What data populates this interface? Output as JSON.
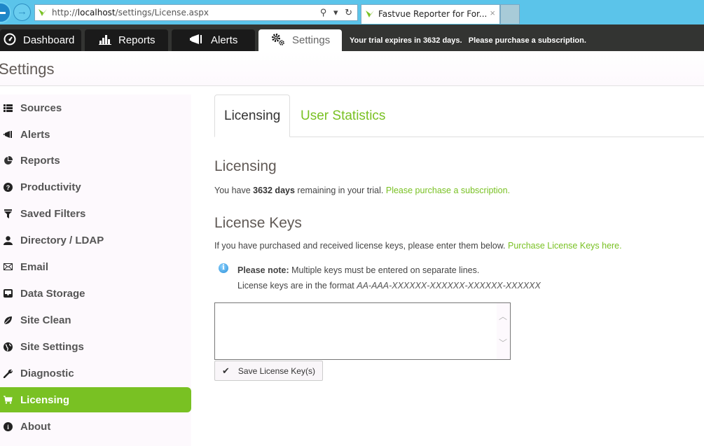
{
  "browser": {
    "url_prefix": "http://",
    "url_host": "localhost",
    "url_path": "/settings/License.aspx",
    "tab_title": "Fastvue Reporter for For...",
    "tab_close": "×",
    "address_tools": "⚲ ▾ ↻",
    "forward_glyph": "→"
  },
  "nav": {
    "tabs": [
      {
        "label": "Dashboard",
        "icon": "dashboard-gauge-icon",
        "glyph": "◔"
      },
      {
        "label": "Reports",
        "icon": "bar-chart-icon",
        "glyph": "▂▆▇"
      },
      {
        "label": "Alerts",
        "icon": "megaphone-icon",
        "glyph": "📢"
      },
      {
        "label": "Settings",
        "icon": "cogs-icon",
        "glyph": "⚙"
      }
    ],
    "trial_notice": "Your trial expires in 3632 days.   Please purchase a subscription."
  },
  "page": {
    "title": "Settings"
  },
  "sidebar": {
    "items": [
      {
        "label": "Sources",
        "glyph": "☷"
      },
      {
        "label": "Alerts",
        "glyph": "◀"
      },
      {
        "label": "Reports",
        "glyph": "◕"
      },
      {
        "label": "Productivity",
        "glyph": "?"
      },
      {
        "label": "Saved Filters",
        "glyph": "▼"
      },
      {
        "label": "Directory / LDAP",
        "glyph": "👤"
      },
      {
        "label": "Email",
        "glyph": "✉"
      },
      {
        "label": "Data Storage",
        "glyph": "▣"
      },
      {
        "label": "Site Clean",
        "glyph": "🍃"
      },
      {
        "label": "Site Settings",
        "glyph": "◉"
      },
      {
        "label": "Diagnostic",
        "glyph": "🔧"
      },
      {
        "label": "Licensing",
        "glyph": "🛒",
        "active": true
      },
      {
        "label": "About",
        "glyph": "i"
      }
    ]
  },
  "main": {
    "tabs": [
      {
        "label": "Licensing",
        "active": true
      },
      {
        "label": "User Statistics",
        "active": false
      }
    ],
    "licensing": {
      "heading": "Licensing",
      "text_before": "You have ",
      "days": "3632 days",
      "text_after": " remaining in your trial. ",
      "purchase_link": "Please purchase a subscription",
      "period": "."
    },
    "license_keys": {
      "heading": "License Keys",
      "intro": "If you have purchased and received license keys, please enter them below. ",
      "purchase_link": "Purchase License Keys here.",
      "note_label": "Please note:",
      "note_text": " Multiple keys must be entered on separate lines.",
      "format_text": "License keys are in the format ",
      "format_value": "AA-AAA-XXXXXX-XXXXXX-XXXXXX-XXXXXX",
      "textarea_value": "",
      "save_label": "Save License Key(s)"
    }
  },
  "colors": {
    "accent": "#79c123",
    "nav_bg": "#333432",
    "browser_chrome": "#5bc4ea"
  }
}
